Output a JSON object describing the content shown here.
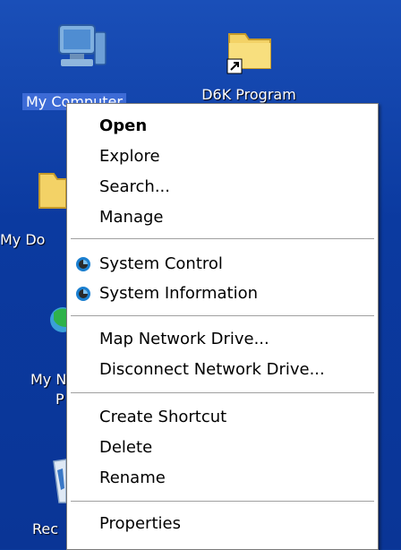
{
  "desktop": {
    "icons": [
      {
        "label": "My Computer",
        "icon": "computer-icon"
      },
      {
        "label": "D6K Program",
        "icon": "folder-shortcut-icon"
      },
      {
        "label": "My Do",
        "icon": "folder-icon"
      },
      {
        "label": "My N",
        "icon": "network-icon"
      },
      {
        "label": "P",
        "icon": "network-icon"
      },
      {
        "label": "Rec",
        "icon": "recycle-bin-icon"
      }
    ]
  },
  "menu": {
    "items": [
      {
        "label": "Open",
        "bold": true
      },
      {
        "label": "Explore"
      },
      {
        "label": "Search..."
      },
      {
        "label": "Manage"
      },
      {
        "label": "System Control",
        "icon": "system-icon"
      },
      {
        "label": "System Information",
        "icon": "system-icon"
      },
      {
        "label": "Map Network Drive..."
      },
      {
        "label": "Disconnect Network Drive..."
      },
      {
        "label": "Create Shortcut"
      },
      {
        "label": "Delete"
      },
      {
        "label": "Rename"
      },
      {
        "label": "Properties"
      }
    ]
  }
}
